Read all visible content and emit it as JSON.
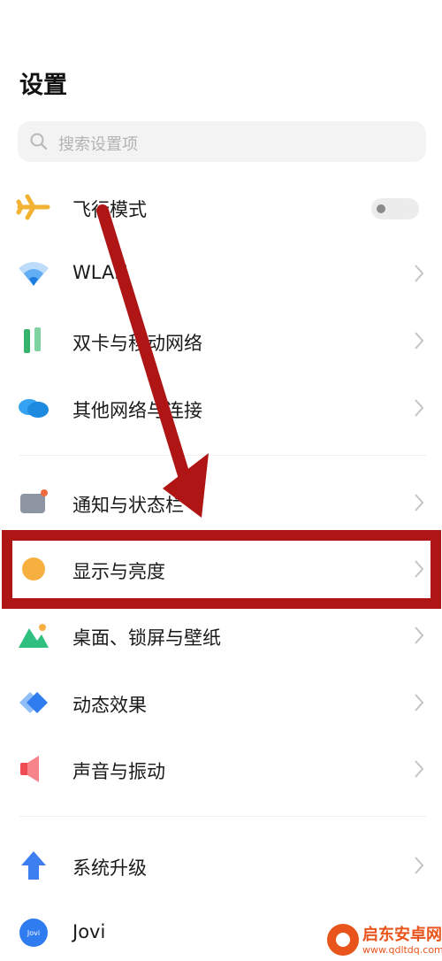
{
  "header": {
    "title": "设置"
  },
  "search": {
    "placeholder": "搜索设置项"
  },
  "settings": {
    "airplane": {
      "label": "飞行模式",
      "toggle_on": false
    },
    "wlan": {
      "label": "WLAN"
    },
    "dual_sim": {
      "label": "双卡与移动网络"
    },
    "other_networks": {
      "label": "其他网络与连接"
    },
    "notifications": {
      "label": "通知与状态栏"
    },
    "display": {
      "label": "显示与亮度"
    },
    "wallpaper": {
      "label": "桌面、锁屏与壁纸"
    },
    "dynamic_effects": {
      "label": "动态效果"
    },
    "sound": {
      "label": "声音与振动"
    },
    "system_update": {
      "label": "系统升级"
    },
    "jovi": {
      "label": "Jovi",
      "icon_text": "Jovi"
    }
  },
  "watermark": {
    "name": "启东安卓网",
    "url": "www.qdltdq.com"
  },
  "colors": {
    "annotation_red": "#b01515",
    "airplane": "#f2b233",
    "wlan": "#2f8ff0",
    "dual_sim": "#35b36b",
    "other_networks": "#36a3f2",
    "display": "#f7b040",
    "dynamic_effects": "#2e7cf0",
    "sound": "#ef4b55",
    "system_update": "#3d7ff0",
    "jovi": "#2e7cf0",
    "watermark": "#e8541c"
  }
}
